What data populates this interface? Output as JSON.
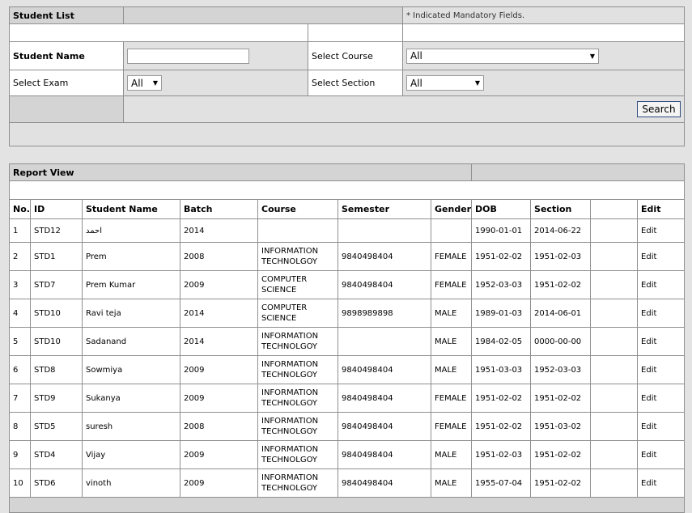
{
  "search_panel": {
    "title": "Student List",
    "mandatory_note": "* Indicated Mandatory Fields.",
    "student_name_label": "Student Name",
    "student_name_value": "",
    "select_course_label": "Select Course",
    "select_course_value": "All",
    "select_exam_label": "Select Exam",
    "select_exam_value": "All",
    "select_section_label": "Select Section",
    "select_section_value": "All",
    "search_button": "Search"
  },
  "report": {
    "title": "Report View",
    "columns": [
      "No.",
      "ID",
      "Student Name",
      "Batch",
      "Course",
      "Semester",
      "Gender",
      "DOB",
      "Section",
      "",
      "Edit"
    ],
    "rows": [
      {
        "no": "1",
        "id": "STD12",
        "name": "احمد",
        "batch": "2014",
        "course_1": "",
        "course_2": "",
        "semester": "",
        "gender": "",
        "dob": "1990-01-01",
        "section": "2014-06-22",
        "extra": "",
        "edit": "Edit"
      },
      {
        "no": "2",
        "id": "STD1",
        "name": "Prem",
        "batch": "2008",
        "course_1": "INFORMATION",
        "course_2": "TECHNOLGOY",
        "semester": "9840498404",
        "gender": "FEMALE",
        "dob": "1951-02-02",
        "section": "1951-02-03",
        "extra": "",
        "edit": "Edit"
      },
      {
        "no": "3",
        "id": "STD7",
        "name": "Prem Kumar",
        "batch": "2009",
        "course_1": "COMPUTER",
        "course_2": "SCIENCE",
        "semester": "9840498404",
        "gender": "FEMALE",
        "dob": "1952-03-03",
        "section": "1951-02-02",
        "extra": "",
        "edit": "Edit"
      },
      {
        "no": "4",
        "id": "STD10",
        "name": "Ravi teja",
        "batch": "2014",
        "course_1": "COMPUTER",
        "course_2": "SCIENCE",
        "semester": "9898989898",
        "gender": "MALE",
        "dob": "1989-01-03",
        "section": "2014-06-01",
        "extra": "",
        "edit": "Edit"
      },
      {
        "no": "5",
        "id": "STD10",
        "name": "Sadanand",
        "batch": "2014",
        "course_1": "INFORMATION",
        "course_2": "TECHNOLGOY",
        "semester": "",
        "gender": "MALE",
        "dob": "1984-02-05",
        "section": "0000-00-00",
        "extra": "",
        "edit": "Edit"
      },
      {
        "no": "6",
        "id": "STD8",
        "name": "Sowmiya",
        "batch": "2009",
        "course_1": "INFORMATION",
        "course_2": "TECHNOLGOY",
        "semester": "9840498404",
        "gender": "MALE",
        "dob": "1951-03-03",
        "section": "1952-03-03",
        "extra": "",
        "edit": "Edit"
      },
      {
        "no": "7",
        "id": "STD9",
        "name": "Sukanya",
        "batch": "2009",
        "course_1": "INFORMATION",
        "course_2": "TECHNOLGOY",
        "semester": "9840498404",
        "gender": "FEMALE",
        "dob": "1951-02-02",
        "section": "1951-02-02",
        "extra": "",
        "edit": "Edit"
      },
      {
        "no": "8",
        "id": "STD5",
        "name": "suresh",
        "batch": "2008",
        "course_1": "INFORMATION",
        "course_2": "TECHNOLGOY",
        "semester": "9840498404",
        "gender": "FEMALE",
        "dob": "1951-02-02",
        "section": "1951-03-02",
        "extra": "",
        "edit": "Edit"
      },
      {
        "no": "9",
        "id": "STD4",
        "name": "Vijay",
        "batch": "2009",
        "course_1": "INFORMATION",
        "course_2": "TECHNOLGOY",
        "semester": "9840498404",
        "gender": "MALE",
        "dob": "1951-02-03",
        "section": "1951-02-02",
        "extra": "",
        "edit": "Edit"
      },
      {
        "no": "10",
        "id": "STD6",
        "name": "vinoth",
        "batch": "2009",
        "course_1": "INFORMATION",
        "course_2": "TECHNOLGOY",
        "semester": "9840498404",
        "gender": "MALE",
        "dob": "1955-07-04",
        "section": "1951-02-02",
        "extra": "",
        "edit": "Edit"
      }
    ]
  }
}
